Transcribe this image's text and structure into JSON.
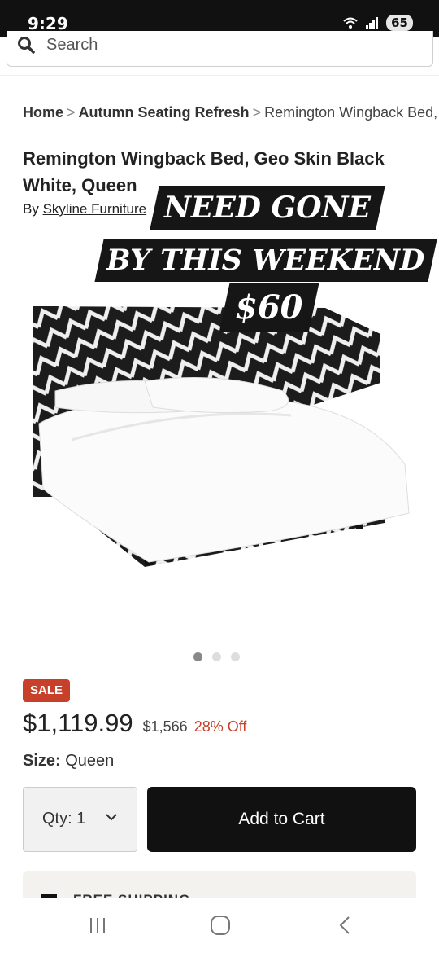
{
  "status_bar": {
    "time": "9:29",
    "battery": "65"
  },
  "search": {
    "placeholder": "Search"
  },
  "breadcrumb": {
    "items": [
      "Home",
      "Autumn Seating Refresh",
      "Remington Wingback Bed, Geo Skin Black White, Queen"
    ],
    "separator": ">"
  },
  "product": {
    "title": "Remington Wingback Bed, Geo Skin Black White, Queen",
    "by_label": "By",
    "brand": "Skyline Furniture"
  },
  "overlay": {
    "line1": "NEED GONE",
    "line2": "BY THIS WEEKEND",
    "line3": "$60"
  },
  "gallery": {
    "image_count": 3,
    "active_index": 0
  },
  "pricing": {
    "sale_badge": "SALE",
    "price": "$1,119.99",
    "original_price": "$1,566",
    "discount": "28% Off"
  },
  "size": {
    "label": "Size:",
    "value": "Queen"
  },
  "quantity": {
    "label": "Qty: 1"
  },
  "cart": {
    "button_label": "Add to Cart"
  },
  "shipping": {
    "label": "FREE SHIPPING"
  },
  "colors": {
    "sale_red": "#c6402a",
    "button_black": "#111111"
  }
}
